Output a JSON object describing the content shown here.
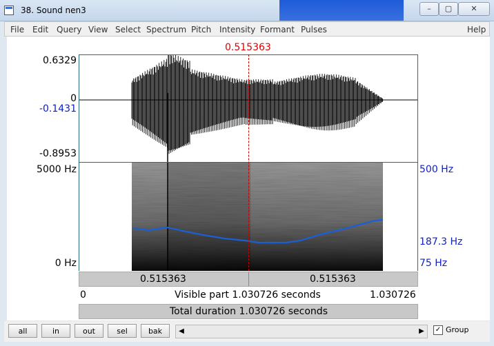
{
  "window": {
    "title": "38. Sound nen3",
    "min_glyph": "–",
    "max_glyph": "▢",
    "close_glyph": "✕"
  },
  "menu": [
    "File",
    "Edit",
    "Query",
    "View",
    "Select",
    "Spectrum",
    "Pitch",
    "Intensity",
    "Formant",
    "Pulses",
    "Help"
  ],
  "cursor_time": "0.515363",
  "waveform": {
    "y_max": "0.6329",
    "y_zero": "0",
    "y_cursor": "-0.1431",
    "y_min": "-0.8953"
  },
  "spectrogram": {
    "freq_top": "5000 Hz",
    "freq_bottom": "0 Hz",
    "pitch_top": "500 Hz",
    "pitch_cursor": "187.3 Hz",
    "pitch_bottom": "75 Hz"
  },
  "selection": {
    "left_time": "0.515363",
    "right_time": "0.515363"
  },
  "visible": {
    "start": "0",
    "label": "Visible part 1.030726 seconds",
    "end": "1.030726"
  },
  "total": {
    "label": "Total duration 1.030726 seconds"
  },
  "controls": {
    "all": "all",
    "in": "in",
    "out": "out",
    "sel": "sel",
    "bak": "bak",
    "group_label": "Group",
    "group_checked": true,
    "scroll_left": "◀",
    "scroll_right": "▶"
  },
  "colors": {
    "cursor": "#d00000",
    "pitch_line": "#1a5fd6",
    "axis_blue": "#1020c0"
  }
}
